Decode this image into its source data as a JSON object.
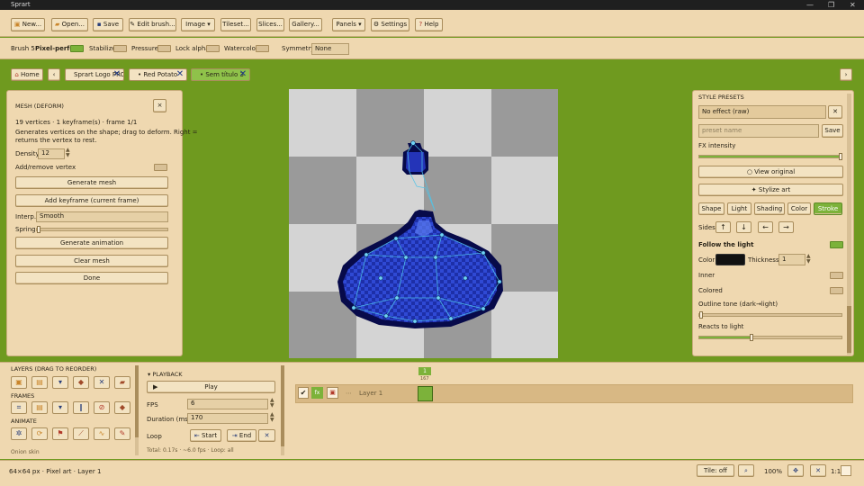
{
  "window": {
    "title": "Sprart"
  },
  "toolbar": {
    "new": "New...",
    "open": "Open...",
    "save": "Save",
    "edit_brush": "Edit brush...",
    "image": "Image ▾",
    "tileset": "Tileset...",
    "slices": "Slices...",
    "gallery": "Gallery...",
    "panels": "Panels ▾",
    "settings": "Settings",
    "help": "Help"
  },
  "brushbar": {
    "brush": "Brush 5",
    "pixel_perfect": "Pixel-perfect",
    "stabilize": "Stabilize",
    "pressure": "Pressure",
    "lock_alpha": "Lock alpha",
    "watercolor": "Watercolor",
    "symmetry": "Symmetry",
    "symmetry_value": "None"
  },
  "tabs": {
    "home": "Home",
    "items": [
      "Sprart Logo PRC",
      "Red Potato",
      "Sem título 3"
    ],
    "nav_prev": "‹",
    "nav_next": "›"
  },
  "mesh": {
    "title": "MESH (DEFORM)",
    "info": "19 vertices · 1 keyframe(s) · frame 1/1",
    "desc1": "Generates vertices on the shape; drag to deform. Right =",
    "desc2": "returns the vertex to rest.",
    "density_label": "Density",
    "density_value": "12",
    "add_remove": "Add/remove vertex",
    "generate_mesh": "Generate mesh",
    "add_keyframe": "Add keyframe (current frame)",
    "interp_label": "Interp.",
    "interp_value": "Smooth",
    "spring_label": "Spring",
    "generate_animation": "Generate animation",
    "clear_mesh": "Clear mesh",
    "done": "Done",
    "close": "×"
  },
  "style": {
    "title": "STYLE PRESETS",
    "preset_value": "No effect (raw)",
    "preset_placeholder": "preset name",
    "save": "Save",
    "fx_label": "FX intensity",
    "fx_value": 0.98,
    "view_original": "○ View original",
    "stylize": "Stylize art",
    "tabs": [
      "Shape",
      "Light",
      "Shading",
      "Color",
      "Stroke"
    ],
    "sides_label": "Sides",
    "sides": [
      "↑",
      "↓",
      "←",
      "→"
    ],
    "follow_light": "Follow the light",
    "color_label": "Color",
    "thickness_label": "Thickness",
    "thickness_value": "1",
    "inner": "Inner",
    "colored": "Colored",
    "outline_tone": "Outline tone (dark→light)",
    "outline_value": 0.0,
    "reacts": "Reacts to light",
    "reacts_value": 0.4,
    "colors": {
      "stroke_color": "#111111"
    }
  },
  "layers": {
    "title": "LAYERS (DRAG TO REORDER)",
    "frames": "FRAMES",
    "animate": "ANIMATE",
    "more": "Onion skin"
  },
  "playback": {
    "title": "▾ PLAYBACK",
    "play": "Play",
    "fps_label": "FPS",
    "fps_value": "6",
    "duration_label": "Duration (ms)",
    "duration_value": "170",
    "loop_label": "Loop",
    "start": "Start",
    "end": "End",
    "total": "Total: 0.17s · ~6.0 fps · Loop: all"
  },
  "timeline": {
    "frame_number": "1",
    "frame_ms": "167",
    "layer_name": "Layer 1",
    "fx": "fx"
  },
  "status": {
    "size": "64×64 px",
    "mode": "Pixel art",
    "layer": "Layer 1",
    "tile": "Tile: off",
    "zoom": "100%",
    "ratio": "1:1"
  }
}
